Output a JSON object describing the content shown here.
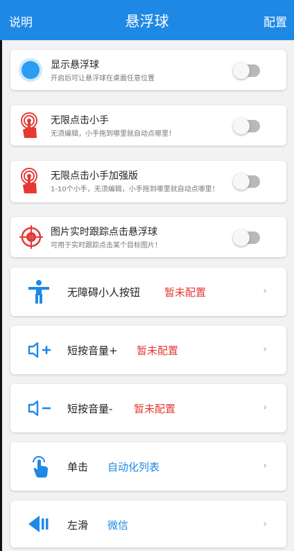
{
  "header": {
    "left": "说明",
    "title": "悬浮球",
    "right": "配置",
    "bg": "#1e88e5"
  },
  "toggles": [
    {
      "title": "显示悬浮球",
      "subtitle": "开启后可让悬浮球在桌面任意位置",
      "icon": "blue-ball-icon",
      "on": false
    },
    {
      "title": "无限点击小手",
      "subtitle": "无须编辑，小手拖到哪里就自动点哪里！",
      "icon": "red-hand-icon",
      "on": false
    },
    {
      "title": "无限点击小手加强版",
      "subtitle": "1-10个小手，无须编辑，小手拖到哪里就自动点哪里！",
      "icon": "red-hand-icon",
      "on": false
    },
    {
      "title": "图片实时跟踪点击悬浮球",
      "subtitle": "可用于实时跟踪点击某个目标图片！",
      "icon": "target-icon",
      "on": false
    }
  ],
  "rows": [
    {
      "label": "无障碍小人按钮",
      "status": "暂未配置",
      "status_color": "#e53935",
      "icon": "accessibility-person-icon"
    },
    {
      "label": "短按音量+",
      "status": "暂未配置",
      "status_color": "#e53935",
      "icon": "volume-up-icon"
    },
    {
      "label": "短按音量-",
      "status": "暂未配置",
      "status_color": "#e53935",
      "icon": "volume-down-icon"
    },
    {
      "label": "单击",
      "status": "自动化列表",
      "status_color": "#1e88e5",
      "icon": "tap-finger-icon"
    },
    {
      "label": "左滑",
      "status": "微信",
      "status_color": "#1e88e5",
      "icon": "swipe-left-icon"
    }
  ],
  "chevron": "›",
  "accent": "#1e88e5"
}
